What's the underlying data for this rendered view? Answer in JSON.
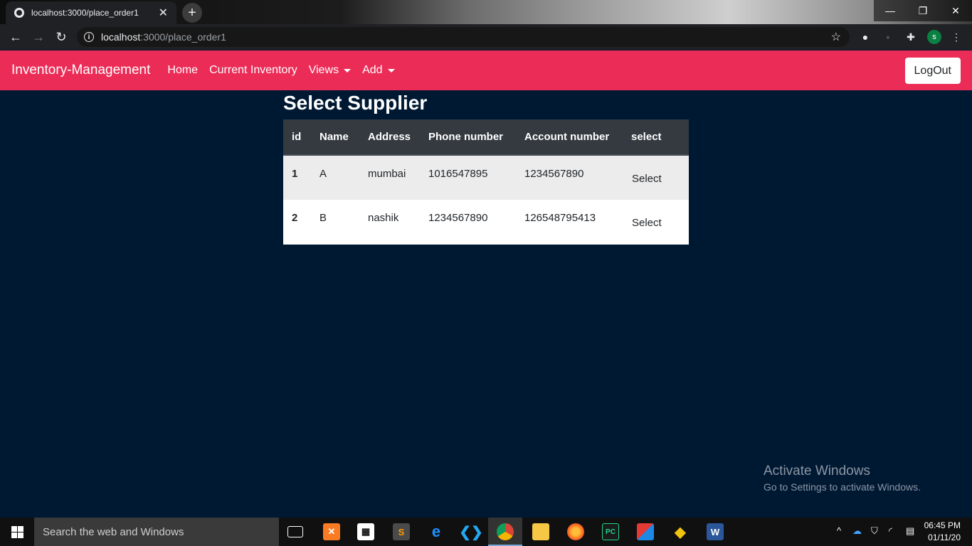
{
  "browser": {
    "tab_title": "localhost:3000/place_order1",
    "url_host": "localhost",
    "url_path": ":3000/place_order1",
    "avatar_initial": "s",
    "window_controls": {
      "minimize": "—",
      "restore": "❐",
      "close": "✕"
    }
  },
  "navbar": {
    "brand": "Inventory-Management",
    "links": [
      "Home",
      "Current Inventory",
      "Views",
      "Add"
    ],
    "logout": "LogOut",
    "bg_color": "#eb2c57"
  },
  "page": {
    "title": "Select Supplier",
    "bg_color": "#001933"
  },
  "table": {
    "headers": [
      "id",
      "Name",
      "Address",
      "Phone number",
      "Account number",
      "select"
    ],
    "rows": [
      {
        "id": "1",
        "name": "A",
        "address": "mumbai",
        "phone": "1016547895",
        "account": "1234567890",
        "action": "Select"
      },
      {
        "id": "2",
        "name": "B",
        "address": "nashik",
        "phone": "1234567890",
        "account": "126548795413",
        "action": "Select"
      }
    ]
  },
  "watermark": {
    "title": "Activate Windows",
    "subtitle": "Go to Settings to activate Windows."
  },
  "taskbar": {
    "search_placeholder": "Search the web and Windows",
    "time": "06:45 PM",
    "date": "01/11/20"
  }
}
